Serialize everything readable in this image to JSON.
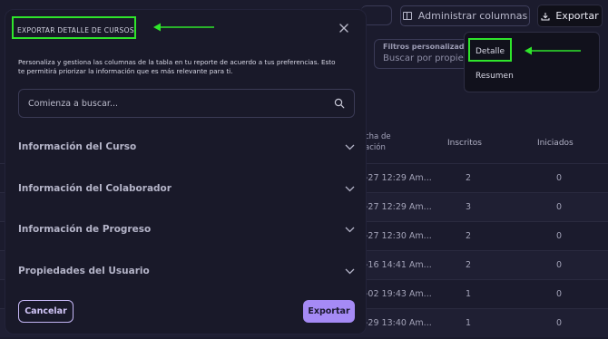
{
  "background": {
    "toolbar": {
      "admin_columns_label": "Administrar columnas",
      "export_label": "Exportar"
    },
    "filters": {
      "label": "Filtros personalizados",
      "placeholder": "Buscar por propiedad"
    },
    "table": {
      "columns": {
        "date_partial": "cha de\nación",
        "enrolled": "Inscritos",
        "started": "Iniciados"
      },
      "rows": [
        {
          "date": "-27 12:29 Am...",
          "enrolled": "2",
          "started": "0"
        },
        {
          "date": "-27 12:29 Am...",
          "enrolled": "3",
          "started": "0"
        },
        {
          "date": "-27 12:30 Am...",
          "enrolled": "2",
          "started": "0"
        },
        {
          "date": "-16 14:41 Am...",
          "enrolled": "2",
          "started": "0"
        },
        {
          "date": "-02 19:43 Am...",
          "enrolled": "1",
          "started": "0"
        },
        {
          "date": "-29 13:40 Am...",
          "enrolled": "1",
          "started": "0"
        }
      ]
    }
  },
  "dropdown": {
    "items": [
      "Detalle",
      "Resumen"
    ],
    "selected": "Detalle"
  },
  "modal": {
    "title": "EXPORTAR DETALLE DE CURSOS",
    "description": "Personaliza y gestiona las columnas de la tabla en tu reporte de acuerdo a tus preferencias. Esto te permitirá priorizar la información que es más relevante para ti.",
    "search_placeholder": "Comienza a buscar...",
    "sections": [
      "Información del Curso",
      "Información del Colaborador",
      "Información de Progreso",
      "Propiedades del Usuario"
    ],
    "cancel_label": "Cancelar",
    "export_label": "Exportar"
  },
  "colors": {
    "accent": "#a58af5",
    "annotation": "#2fe52b",
    "modal_bg": "#191929",
    "page_bg": "#1b1b2d"
  }
}
